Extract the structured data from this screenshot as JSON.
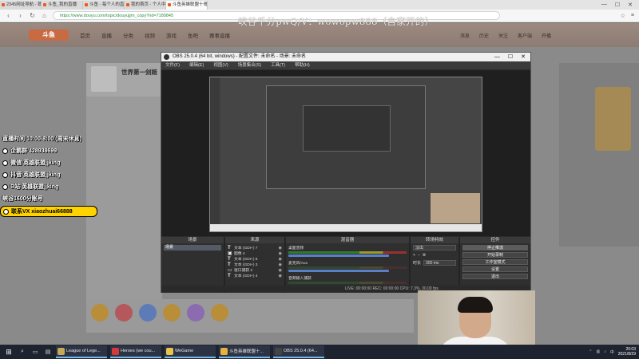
{
  "browser": {
    "tabs": [
      {
        "label": "2345网址导航 - 致力于打造百",
        "active": false
      },
      {
        "label": "斗鱼_我的直播",
        "active": false
      },
      {
        "label": "斗鱼 - 每个人的直播平台",
        "active": false
      },
      {
        "label": "我的首页 - 个人中心 - 斗鱼",
        "active": false
      },
      {
        "label": "斗鱼英雄联盟十哥年电竞跑",
        "active": true
      }
    ],
    "url": "https://www.douyu.com/topic/douyujjrn_copy?rid=7180845"
  },
  "douyu": {
    "logo": "斗鱼",
    "nav": [
      "首页",
      "直播",
      "分类",
      "视频",
      "游戏",
      "鱼吧",
      "赛事直播"
    ],
    "right_nav": [
      "消息",
      "历史",
      "关注",
      "客户端",
      "开播"
    ],
    "promo": "峡谷千分pwQ/V：wowopw888（自家开的）",
    "room_title": "世界第一剑姬"
  },
  "overlay": {
    "lines": [
      "直播时间  10:00-8:00  (周末休息)",
      "企鹅群  428938699",
      "微信  英雄联盟jjking",
      "抖音  英雄联盟jjking",
      "B站  英雄联盟jjking",
      "峡谷1600分账号",
      "联系VX  xiaozhuai66888"
    ]
  },
  "obs": {
    "title": "OBS 25.0.4 (64 bit, windows) - 配置文件: 未命名 - 场景: 未命名",
    "menu": [
      "文件(F)",
      "编辑(E)",
      "视图(V)",
      "场景集合(S)",
      "工具(T)",
      "帮助(H)"
    ],
    "docks": {
      "scenes": {
        "title": "场景",
        "items": [
          "场景"
        ]
      },
      "sources": {
        "title": "来源",
        "items": [
          "文本 (GDI+) 7",
          "图像 4",
          "文本 (GDI+) 5",
          "文本 (GDI+) 3",
          "窗口捕获 2",
          "文本 (GDI+) 4"
        ]
      },
      "mixer": {
        "title": "混音器",
        "channels": [
          "桌面音频",
          "麦克风/Aux",
          "音频输入捕获"
        ]
      },
      "transitions": {
        "title": "转场特效",
        "type": "淡出",
        "duration_label": "时长",
        "duration": "300 ms"
      },
      "controls": {
        "title": "控件",
        "buttons": [
          "停止推流",
          "开始录制",
          "工作室模式",
          "设置",
          "退出"
        ]
      }
    },
    "status": "LIVE: 00:00:00   REC: 00:00:00   CPU: 7.3%, 30.00 fps"
  },
  "taskbar": {
    "apps": [
      {
        "label": "League of Lege...",
        "color": "#c8a85a"
      },
      {
        "label": "Heroes (we cou...",
        "color": "#d33b3b"
      },
      {
        "label": "WeGame",
        "color": "#e9c44a"
      },
      {
        "label": "斗鱼英雄联盟十...",
        "color": "#e8b23a"
      },
      {
        "label": "OBS 25.0.4 (64...",
        "color": "#444444"
      }
    ],
    "time": "20:03",
    "date": "2021/8/29"
  }
}
